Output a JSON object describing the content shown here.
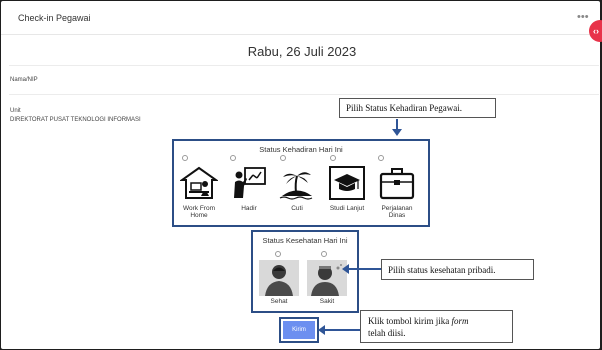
{
  "window": {
    "title": "Check-in Pegawai"
  },
  "header": {
    "more_icon": "more-horizontal-icon",
    "fab_icon": "code-icon"
  },
  "main": {
    "date": "Rabu, 26 Juli 2023",
    "nama_label": "Nama/NIP",
    "unit_label": "Unit",
    "unit_value": "DIREKTORAT PUSAT TEKNOLOGI INFORMASI"
  },
  "attendance": {
    "title": "Status Kehadiran Hari Ini",
    "options": [
      {
        "label_line1": "Work From",
        "label_line2": "Home",
        "icon": "house-person-icon"
      },
      {
        "label_line1": "Hadir",
        "label_line2": "",
        "icon": "presenter-icon"
      },
      {
        "label_line1": "Cuti",
        "label_line2": "",
        "icon": "beach-island-icon"
      },
      {
        "label_line1": "Studi Lanjut",
        "label_line2": "",
        "icon": "graduation-cap-icon"
      },
      {
        "label_line1": "Perjalanan",
        "label_line2": "Dinas",
        "icon": "briefcase-icon"
      }
    ]
  },
  "health": {
    "title": "Status Kesehatan Hari Ini",
    "options": [
      {
        "label": "Sehat",
        "icon": "healthy-person-icon"
      },
      {
        "label": "Sakit",
        "icon": "sick-person-icon"
      }
    ]
  },
  "submit": {
    "label": "Kirim"
  },
  "callouts": {
    "attendance": "Pilih Status Kehadiran Pegawai.",
    "health": "Pilih status kesehatan pribadi.",
    "submit_pre": "Klik tombol kirim jika ",
    "submit_em": "form",
    "submit_post": "telah diisi."
  },
  "colors": {
    "accent": "#2c4e86",
    "arrow": "#2f5597",
    "button": "#6c8ff0",
    "fab": "#e8334a"
  }
}
